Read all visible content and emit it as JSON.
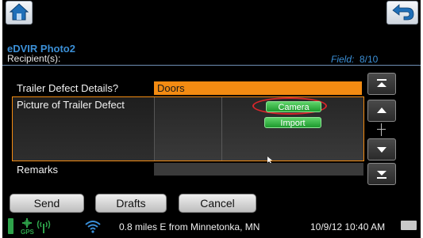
{
  "header": {
    "title": "eDVIR Photo2",
    "recipients_label": "Recipient(s):",
    "field_label": "Field:",
    "field_value": "8/10"
  },
  "form": {
    "defect_details_label": "Trailer Defect Details?",
    "defect_details_value": "Doors",
    "picture_label": "Picture of Trailer Defect",
    "camera_label": "Camera",
    "import_label": "Import",
    "remarks_label": "Remarks",
    "remarks_value": ""
  },
  "actions": {
    "send_label": "Send",
    "drafts_label": "Drafts",
    "cancel_label": "Cancel"
  },
  "status": {
    "gps_label": "GPS",
    "location": "0.8 miles E from Minnetonka, MN",
    "datetime": "10/9/12 10:40 AM"
  },
  "colors": {
    "accent_orange": "#f38b12",
    "title_blue": "#3b8fd6",
    "button_green": "#1d9a2d",
    "highlight_red": "#d8262b"
  },
  "icons": [
    "home-icon",
    "back-arrow-icon",
    "scroll-top-icon",
    "scroll-up-icon",
    "scroll-down-icon",
    "scroll-bottom-icon",
    "battery-icon",
    "gps-icon",
    "signal-icon",
    "wifi-icon",
    "keyboard-icon",
    "cursor-icon"
  ]
}
